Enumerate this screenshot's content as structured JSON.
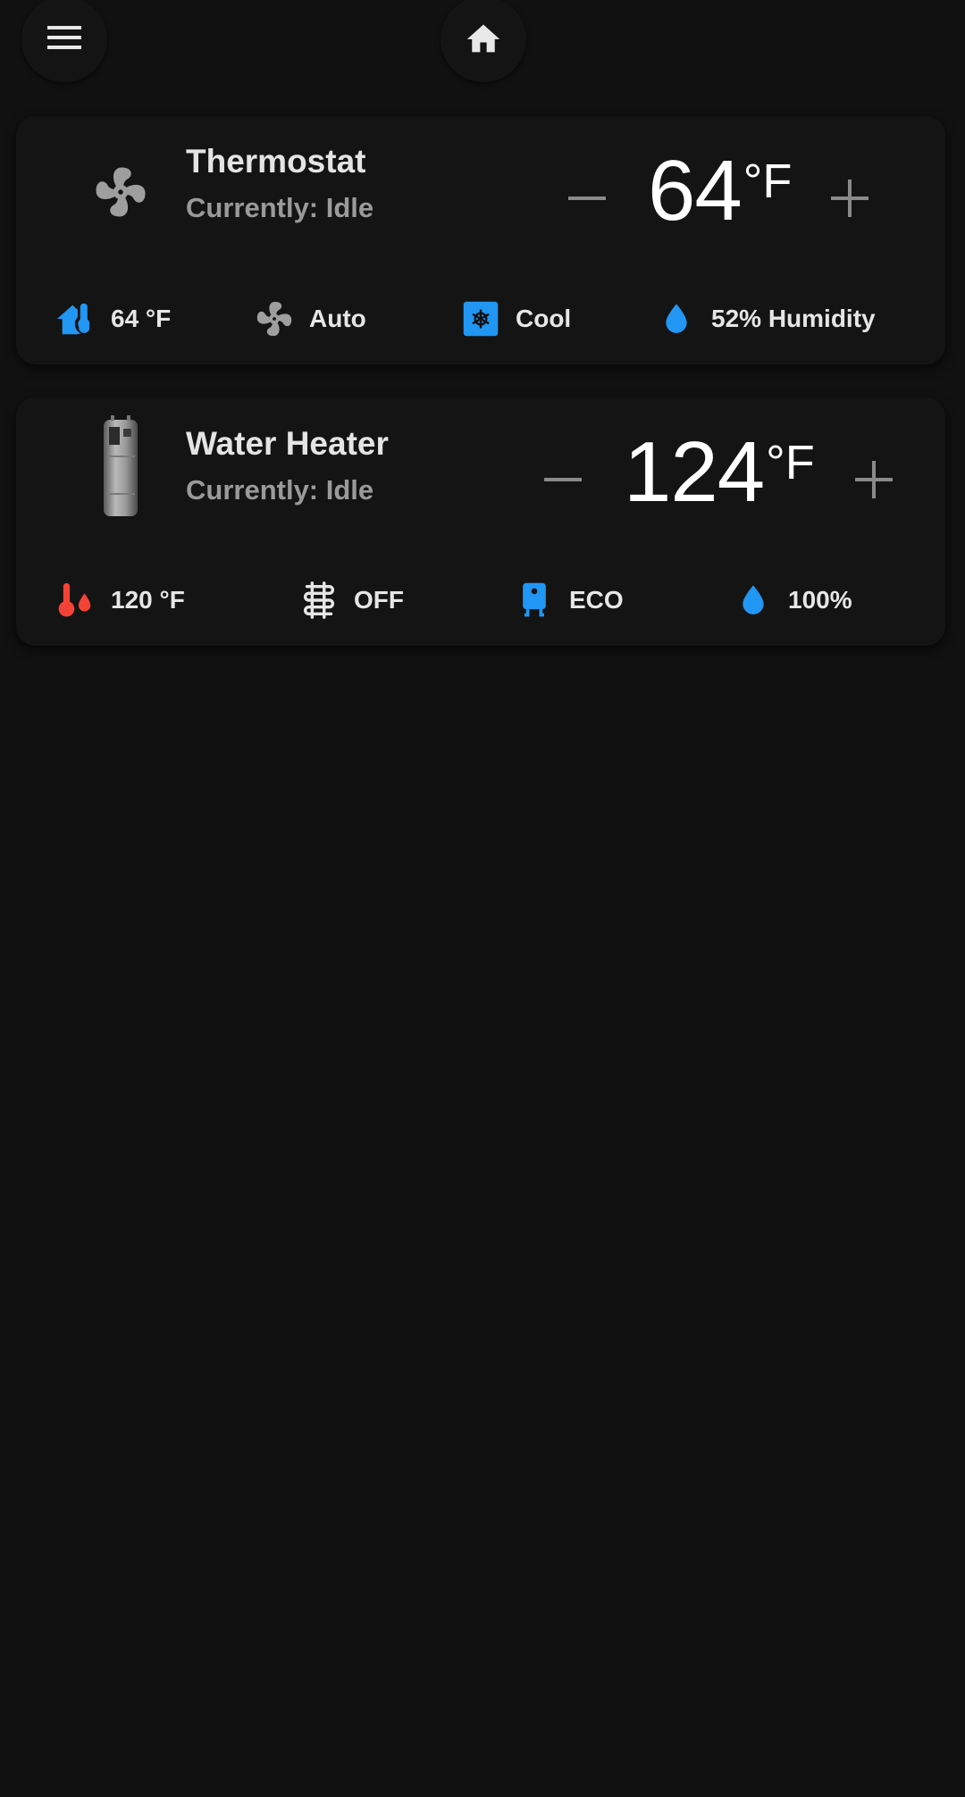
{
  "topbar": {
    "menu_icon": "menu-icon",
    "home_icon": "home-icon"
  },
  "colors": {
    "background": "#111111",
    "card": "#141414",
    "accent_blue": "#2196f3",
    "accent_red": "#f44336",
    "muted": "#9a9a9a"
  },
  "thermostat": {
    "name": "Thermostat",
    "state": "Currently: Idle",
    "target": "64",
    "unit": "°F",
    "icon": "fan-icon",
    "attributes": [
      {
        "icon": "home-thermometer-icon",
        "label": "64 °F"
      },
      {
        "icon": "fan-icon",
        "label": "Auto"
      },
      {
        "icon": "snowflake-icon",
        "label": "Cool"
      },
      {
        "icon": "water-drop-icon",
        "label": "52% Humidity"
      }
    ]
  },
  "water_heater": {
    "name": "Water Heater",
    "state": "Currently: Idle",
    "target": "124",
    "unit": "°F",
    "icon": "water-heater-image",
    "attributes": [
      {
        "icon": "thermometer-water-icon",
        "label": "120 °F"
      },
      {
        "icon": "heating-coil-icon",
        "label": "OFF"
      },
      {
        "icon": "water-boiler-icon",
        "label": "ECO"
      },
      {
        "icon": "water-drop-icon",
        "label": "100%"
      }
    ]
  }
}
